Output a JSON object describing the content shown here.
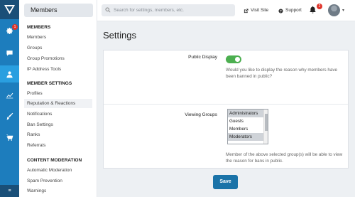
{
  "iconbar": {
    "badge_count": "1",
    "bottom_label": "≡",
    "icons": [
      "logo-icon",
      "gear-icon",
      "chat-icon",
      "user-icon",
      "chart-icon",
      "brush-icon",
      "cart-icon"
    ],
    "active_index": 3
  },
  "subnav": {
    "title": "Members",
    "sections": [
      {
        "title": "MEMBERS",
        "items": [
          "Members",
          "Groups",
          "Group Promotions",
          "IP Address Tools"
        ]
      },
      {
        "title": "MEMBER SETTINGS",
        "items": [
          "Profiles",
          "Reputation & Reactions",
          "Notifications",
          "Ban Settings",
          "Ranks",
          "Referrals"
        ]
      },
      {
        "title": "CONTENT MODERATION",
        "items": [
          "Automatic Moderation",
          "Spam Prevention",
          "Warnings"
        ]
      }
    ],
    "active_item": "Reputation & Reactions"
  },
  "topbar": {
    "search_placeholder": "Search for settings, members, etc.",
    "visit_site": "Visit Site",
    "support": "Support",
    "notification_count": "2"
  },
  "main": {
    "title": "Settings",
    "public_display": {
      "label": "Public Display",
      "enabled": true,
      "hint": "Would you like to display the reason why members have been banned in public?"
    },
    "viewing_groups": {
      "label": "Viewing Groups",
      "options": [
        {
          "label": "Administrators",
          "selected": true
        },
        {
          "label": "Guests",
          "selected": false
        },
        {
          "label": "Members",
          "selected": false
        },
        {
          "label": "Moderators",
          "selected": true
        }
      ],
      "hint": "Member of the above selected group(s) will be able to view the reason for bans in public."
    },
    "save_label": "Save"
  },
  "colors": {
    "iconbar": "#1d7dbd",
    "iconbar_dark": "#1a4f78",
    "toggle_on": "#4caf50",
    "save_button": "#1a73a8",
    "badge": "#e0342a"
  }
}
